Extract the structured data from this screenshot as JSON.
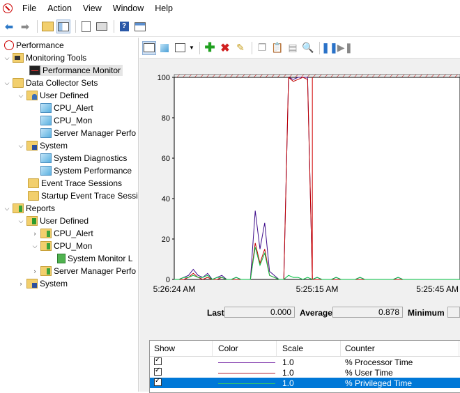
{
  "menu": [
    "File",
    "Action",
    "View",
    "Window",
    "Help"
  ],
  "toolbar_icons": [
    "back-icon",
    "forward-icon",
    "up-folder-icon",
    "show-hide-tree-icon",
    "export-list-icon",
    "print-icon",
    "help-icon",
    "properties-icon"
  ],
  "tree": {
    "root": "Performance",
    "monitoring_tools": "Monitoring Tools",
    "performance_monitor": "Performance Monitor",
    "data_collector_sets": "Data Collector Sets",
    "dcs_user_defined": "User Defined",
    "cpu_alert": "CPU_Alert",
    "cpu_mon": "CPU_Mon",
    "server_manager_perf": "Server Manager Perfo",
    "system": "System",
    "system_diagnostics": "System Diagnostics",
    "system_performance": "System Performance",
    "event_trace_sessions": "Event Trace Sessions",
    "startup_event_trace": "Startup Event Trace Sessi",
    "reports": "Reports",
    "rep_user_defined": "User Defined",
    "rep_cpu_alert": "CPU_Alert",
    "rep_cpu_mon": "CPU_Mon",
    "rep_system_monitor": "System Monitor L",
    "rep_server_manager": "Server Manager Perfo",
    "rep_system": "System"
  },
  "chart_data": {
    "type": "line",
    "y_ticks": [
      "100",
      "80",
      "60",
      "40",
      "20",
      "0"
    ],
    "ylim": [
      0,
      100
    ],
    "x_labels": [
      "5:26:24 AM",
      "5:25:15 AM",
      "5:25:45 AM"
    ],
    "series": [
      {
        "name": "% Processor Time",
        "color": "#3d0b8a",
        "values": [
          0,
          0,
          1,
          2,
          5,
          2,
          1,
          3,
          0,
          1,
          2,
          0,
          0,
          1,
          0,
          0,
          0,
          34,
          15,
          28,
          4,
          2,
          0,
          0,
          100,
          99,
          100,
          100,
          100,
          0,
          1,
          0,
          0,
          0,
          1,
          0,
          0,
          0,
          0,
          1,
          0,
          0,
          0,
          0,
          0,
          0,
          0,
          1,
          0,
          0,
          0,
          0,
          0,
          0,
          0,
          0,
          0,
          0,
          0,
          0,
          0
        ]
      },
      {
        "name": "% User Time",
        "color": "#c00000",
        "values": [
          0,
          0,
          0,
          1,
          3,
          1,
          0,
          1,
          0,
          0,
          1,
          0,
          0,
          0,
          0,
          0,
          0,
          18,
          8,
          15,
          2,
          1,
          0,
          0,
          100,
          98,
          99,
          100,
          99,
          0,
          0,
          0,
          0,
          0,
          0,
          0,
          0,
          0,
          0,
          0,
          0,
          0,
          0,
          0,
          0,
          0,
          0,
          0,
          0,
          0,
          0,
          0,
          0,
          0,
          0,
          0,
          0,
          0,
          0,
          0,
          0
        ]
      },
      {
        "name": "% Privileged Time",
        "color": "#00c040",
        "values": [
          0,
          0,
          1,
          1,
          2,
          1,
          1,
          2,
          0,
          1,
          1,
          0,
          0,
          1,
          0,
          0,
          0,
          16,
          7,
          13,
          2,
          1,
          0,
          0,
          2,
          1,
          1,
          0,
          1,
          0,
          1,
          0,
          0,
          0,
          1,
          0,
          0,
          0,
          0,
          1,
          0,
          0,
          0,
          0,
          0,
          0,
          0,
          1,
          0,
          0,
          0,
          0,
          0,
          0,
          0,
          0,
          0,
          0,
          0,
          0,
          0
        ]
      }
    ],
    "current_time_index": 29,
    "grid": false
  },
  "stats": {
    "last_label": "Last",
    "last_value": "0.000",
    "average_label": "Average",
    "average_value": "0.878",
    "minimum_label": "Minimum"
  },
  "counter_table": {
    "headers": [
      "Show",
      "Color",
      "Scale",
      "Counter"
    ],
    "rows": [
      {
        "scale": "1.0",
        "counter": "% Processor Time",
        "color": "#7a2fa8"
      },
      {
        "scale": "1.0",
        "counter": "% User Time",
        "color": "#b02030"
      },
      {
        "scale": "1.0",
        "counter": "% Privileged Time",
        "color": "#30c070"
      }
    ]
  }
}
